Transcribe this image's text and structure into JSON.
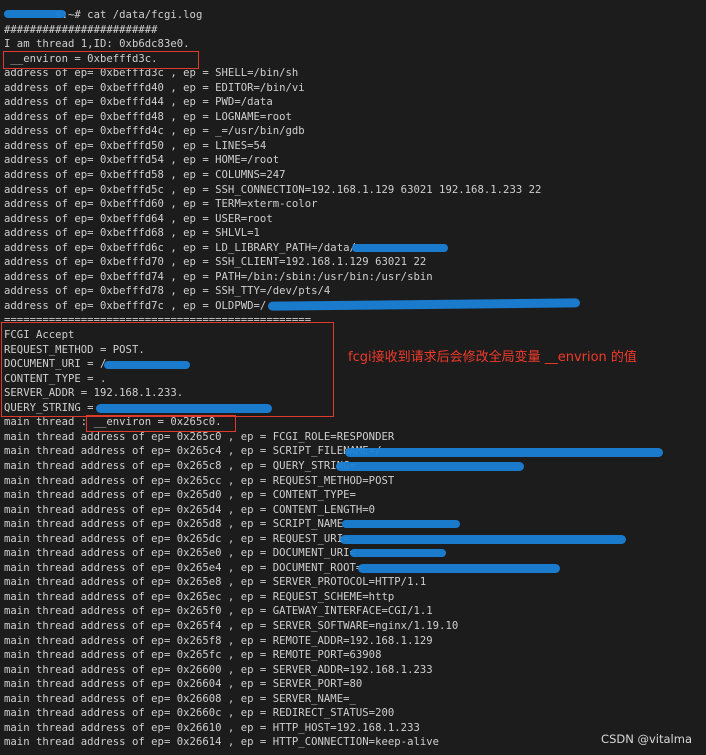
{
  "terminal": {
    "lines": [
      "        s:~# cat /data/fcgi.log",
      "########################",
      "I am thread 1,ID: 0xb6dc83e0.",
      " __environ = 0xbefffd3c.",
      "address of ep= 0xbefffd3c , ep = SHELL=/bin/sh",
      "address of ep= 0xbefffd40 , ep = EDITOR=/bin/vi",
      "address of ep= 0xbefffd44 , ep = PWD=/data",
      "address of ep= 0xbefffd48 , ep = LOGNAME=root",
      "address of ep= 0xbefffd4c , ep = _=/usr/bin/gdb",
      "address of ep= 0xbefffd50 , ep = LINES=54",
      "address of ep= 0xbefffd54 , ep = HOME=/root",
      "address of ep= 0xbefffd58 , ep = COLUMNS=247",
      "address of ep= 0xbefffd5c , ep = SSH_CONNECTION=192.168.1.129 63021 192.168.1.233 22",
      "address of ep= 0xbefffd60 , ep = TERM=xterm-color",
      "address of ep= 0xbefffd64 , ep = USER=root",
      "address of ep= 0xbefffd68 , ep = SHLVL=1",
      "address of ep= 0xbefffd6c , ep = LD_LIBRARY_PATH=/data/",
      "address of ep= 0xbefffd70 , ep = SSH_CLIENT=192.168.1.129 63021 22",
      "address of ep= 0xbefffd74 , ep = PATH=/bin:/sbin:/usr/bin:/usr/sbin",
      "address of ep= 0xbefffd78 , ep = SSH_TTY=/dev/pts/4",
      "address of ep= 0xbefffd7c , ep = OLDPWD=/",
      "================================================",
      "FCGI Accept",
      "REQUEST_METHOD = POST.",
      "DOCUMENT_URI = /",
      "CONTENT_TYPE = .",
      "SERVER_ADDR = 192.168.1.233.",
      "QUERY_STRING = ",
      "main thread : __environ = 0x265c0.",
      "main thread address of ep= 0x265c0 , ep = FCGI_ROLE=RESPONDER",
      "main thread address of ep= 0x265c4 , ep = SCRIPT_FILENAME=/",
      "main thread address of ep= 0x265c8 , ep = QUERY_STRING=",
      "main thread address of ep= 0x265cc , ep = REQUEST_METHOD=POST",
      "main thread address of ep= 0x265d0 , ep = CONTENT_TYPE=",
      "main thread address of ep= 0x265d4 , ep = CONTENT_LENGTH=0",
      "main thread address of ep= 0x265d8 , ep = SCRIPT_NAME",
      "main thread address of ep= 0x265dc , ep = REQUEST_URI=",
      "main thread address of ep= 0x265e0 , ep = DOCUMENT_URI=",
      "main thread address of ep= 0x265e4 , ep = DOCUMENT_ROOT=",
      "main thread address of ep= 0x265e8 , ep = SERVER_PROTOCOL=HTTP/1.1",
      "main thread address of ep= 0x265ec , ep = REQUEST_SCHEME=http",
      "main thread address of ep= 0x265f0 , ep = GATEWAY_INTERFACE=CGI/1.1",
      "main thread address of ep= 0x265f4 , ep = SERVER_SOFTWARE=nginx/1.19.10",
      "main thread address of ep= 0x265f8 , ep = REMOTE_ADDR=192.168.1.129",
      "main thread address of ep= 0x265fc , ep = REMOTE_PORT=63908",
      "main thread address of ep= 0x26600 , ep = SERVER_ADDR=192.168.1.233",
      "main thread address of ep= 0x26604 , ep = SERVER_PORT=80",
      "main thread address of ep= 0x26608 , ep = SERVER_NAME=_",
      "main thread address of ep= 0x2660c , ep = REDIRECT_STATUS=200",
      "main thread address of ep= 0x26610 , ep = HTTP_HOST=192.168.1.233",
      "main thread address of ep= 0x26614 , ep = HTTP_CONNECTION=keep-alive"
    ]
  },
  "annotation": {
    "text": "fcgi接收到请求后会修改全局变量 __envrion 的值"
  },
  "watermark": {
    "text": "CSDN @vitalma"
  },
  "colors": {
    "terminal_bg": "#1c1c1c",
    "terminal_text": "#cfcfcf",
    "highlight_box": "#e03a2c",
    "annotation_text": "#f03a2a",
    "redaction": "#1a7fd6"
  }
}
